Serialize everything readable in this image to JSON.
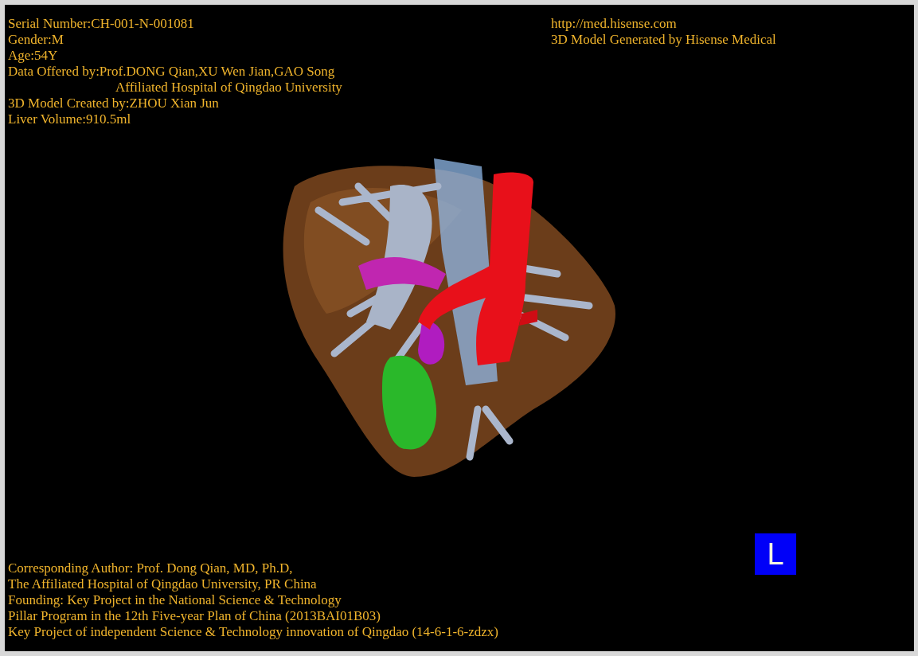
{
  "info_top_left": [
    {
      "kind": "line",
      "text": "Serial Number:CH-001-N-001081"
    },
    {
      "kind": "line",
      "text": "Gender:M"
    },
    {
      "kind": "line",
      "text": "Age:54Y"
    },
    {
      "kind": "line",
      "text": "Data Offered by:Prof.DONG Qian,XU Wen Jian,GAO Song"
    },
    {
      "kind": "indented",
      "text": "Affiliated Hospital of Qingdao University"
    },
    {
      "kind": "line",
      "text": "3D Model Created by:ZHOU Xian Jun"
    },
    {
      "kind": "line",
      "text": "Liver Volume:910.5ml"
    }
  ],
  "info_top_right": [
    "http://med.hisense.com",
    "3D Model Generated by Hisense Medical"
  ],
  "viewport": {
    "kind": "model"
  },
  "info_bottom": [
    "Corresponding Author: Prof. Dong Qian, MD, Ph.D,",
    "The Affiliated Hospital of Qingdao University, PR China",
    "Founding: Key Project in the National Science & Technology",
    "Pillar Program in the 12th Five-year Plan of China (2013BAI01B03)",
    "Key Project of independent Science & Technology innovation of Qingdao (14-6-1-6-zdzx)"
  ],
  "orientation_badge": "L"
}
